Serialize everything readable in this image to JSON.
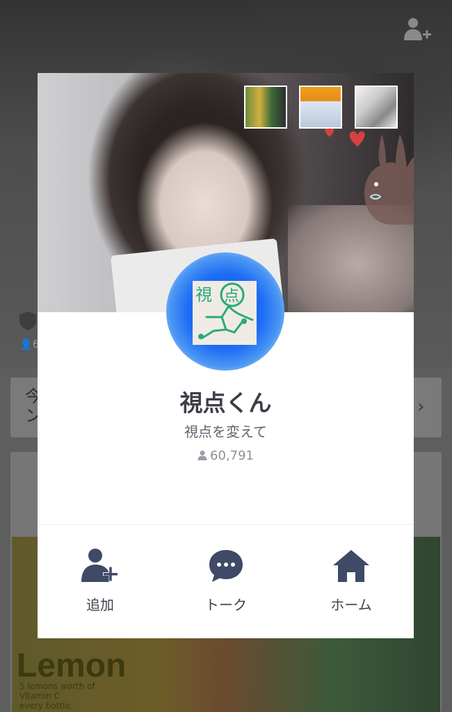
{
  "background": {
    "friend_count": "6",
    "card_text": "今\nン",
    "photo_text": "Lemon",
    "photo_small_text": "5 lemons worth of\nVitamin C\nevery bottle."
  },
  "profile": {
    "name": "視点くん",
    "status_message": "視点を変えて",
    "friend_count": "60,791"
  },
  "actions": [
    {
      "label": "追加",
      "icon": "add-friend-icon"
    },
    {
      "label": "トーク",
      "icon": "chat-bubble-icon"
    },
    {
      "label": "ホーム",
      "icon": "home-icon"
    }
  ],
  "colors": {
    "accent_icon": "#3e4a66",
    "name_text": "#3e3e48",
    "avatar_ring": "#1d6cf4"
  }
}
